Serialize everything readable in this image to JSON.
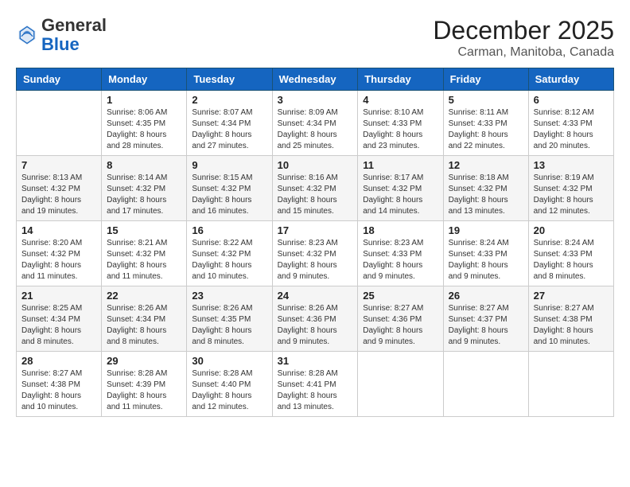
{
  "logo": {
    "general": "General",
    "blue": "Blue"
  },
  "title": "December 2025",
  "location": "Carman, Manitoba, Canada",
  "days_of_week": [
    "Sunday",
    "Monday",
    "Tuesday",
    "Wednesday",
    "Thursday",
    "Friday",
    "Saturday"
  ],
  "weeks": [
    [
      {
        "day": "",
        "info": ""
      },
      {
        "day": "1",
        "info": "Sunrise: 8:06 AM\nSunset: 4:35 PM\nDaylight: 8 hours\nand 28 minutes."
      },
      {
        "day": "2",
        "info": "Sunrise: 8:07 AM\nSunset: 4:34 PM\nDaylight: 8 hours\nand 27 minutes."
      },
      {
        "day": "3",
        "info": "Sunrise: 8:09 AM\nSunset: 4:34 PM\nDaylight: 8 hours\nand 25 minutes."
      },
      {
        "day": "4",
        "info": "Sunrise: 8:10 AM\nSunset: 4:33 PM\nDaylight: 8 hours\nand 23 minutes."
      },
      {
        "day": "5",
        "info": "Sunrise: 8:11 AM\nSunset: 4:33 PM\nDaylight: 8 hours\nand 22 minutes."
      },
      {
        "day": "6",
        "info": "Sunrise: 8:12 AM\nSunset: 4:33 PM\nDaylight: 8 hours\nand 20 minutes."
      }
    ],
    [
      {
        "day": "7",
        "info": "Sunrise: 8:13 AM\nSunset: 4:32 PM\nDaylight: 8 hours\nand 19 minutes."
      },
      {
        "day": "8",
        "info": "Sunrise: 8:14 AM\nSunset: 4:32 PM\nDaylight: 8 hours\nand 17 minutes."
      },
      {
        "day": "9",
        "info": "Sunrise: 8:15 AM\nSunset: 4:32 PM\nDaylight: 8 hours\nand 16 minutes."
      },
      {
        "day": "10",
        "info": "Sunrise: 8:16 AM\nSunset: 4:32 PM\nDaylight: 8 hours\nand 15 minutes."
      },
      {
        "day": "11",
        "info": "Sunrise: 8:17 AM\nSunset: 4:32 PM\nDaylight: 8 hours\nand 14 minutes."
      },
      {
        "day": "12",
        "info": "Sunrise: 8:18 AM\nSunset: 4:32 PM\nDaylight: 8 hours\nand 13 minutes."
      },
      {
        "day": "13",
        "info": "Sunrise: 8:19 AM\nSunset: 4:32 PM\nDaylight: 8 hours\nand 12 minutes."
      }
    ],
    [
      {
        "day": "14",
        "info": "Sunrise: 8:20 AM\nSunset: 4:32 PM\nDaylight: 8 hours\nand 11 minutes."
      },
      {
        "day": "15",
        "info": "Sunrise: 8:21 AM\nSunset: 4:32 PM\nDaylight: 8 hours\nand 11 minutes."
      },
      {
        "day": "16",
        "info": "Sunrise: 8:22 AM\nSunset: 4:32 PM\nDaylight: 8 hours\nand 10 minutes."
      },
      {
        "day": "17",
        "info": "Sunrise: 8:23 AM\nSunset: 4:32 PM\nDaylight: 8 hours\nand 9 minutes."
      },
      {
        "day": "18",
        "info": "Sunrise: 8:23 AM\nSunset: 4:33 PM\nDaylight: 8 hours\nand 9 minutes."
      },
      {
        "day": "19",
        "info": "Sunrise: 8:24 AM\nSunset: 4:33 PM\nDaylight: 8 hours\nand 9 minutes."
      },
      {
        "day": "20",
        "info": "Sunrise: 8:24 AM\nSunset: 4:33 PM\nDaylight: 8 hours\nand 8 minutes."
      }
    ],
    [
      {
        "day": "21",
        "info": "Sunrise: 8:25 AM\nSunset: 4:34 PM\nDaylight: 8 hours\nand 8 minutes."
      },
      {
        "day": "22",
        "info": "Sunrise: 8:26 AM\nSunset: 4:34 PM\nDaylight: 8 hours\nand 8 minutes."
      },
      {
        "day": "23",
        "info": "Sunrise: 8:26 AM\nSunset: 4:35 PM\nDaylight: 8 hours\nand 8 minutes."
      },
      {
        "day": "24",
        "info": "Sunrise: 8:26 AM\nSunset: 4:36 PM\nDaylight: 8 hours\nand 9 minutes."
      },
      {
        "day": "25",
        "info": "Sunrise: 8:27 AM\nSunset: 4:36 PM\nDaylight: 8 hours\nand 9 minutes."
      },
      {
        "day": "26",
        "info": "Sunrise: 8:27 AM\nSunset: 4:37 PM\nDaylight: 8 hours\nand 9 minutes."
      },
      {
        "day": "27",
        "info": "Sunrise: 8:27 AM\nSunset: 4:38 PM\nDaylight: 8 hours\nand 10 minutes."
      }
    ],
    [
      {
        "day": "28",
        "info": "Sunrise: 8:27 AM\nSunset: 4:38 PM\nDaylight: 8 hours\nand 10 minutes."
      },
      {
        "day": "29",
        "info": "Sunrise: 8:28 AM\nSunset: 4:39 PM\nDaylight: 8 hours\nand 11 minutes."
      },
      {
        "day": "30",
        "info": "Sunrise: 8:28 AM\nSunset: 4:40 PM\nDaylight: 8 hours\nand 12 minutes."
      },
      {
        "day": "31",
        "info": "Sunrise: 8:28 AM\nSunset: 4:41 PM\nDaylight: 8 hours\nand 13 minutes."
      },
      {
        "day": "",
        "info": ""
      },
      {
        "day": "",
        "info": ""
      },
      {
        "day": "",
        "info": ""
      }
    ]
  ]
}
